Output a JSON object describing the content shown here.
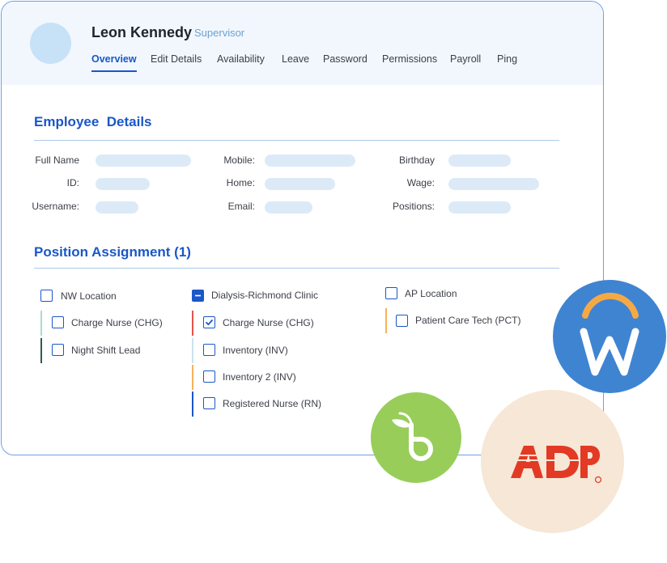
{
  "profile": {
    "name": "Leon Kennedy",
    "role": "Supervisor"
  },
  "tabs": [
    {
      "label": "Overview",
      "active": true
    },
    {
      "label": "Edit Details",
      "active": false
    },
    {
      "label": "Availability",
      "active": false
    },
    {
      "label": "Leave",
      "active": false
    },
    {
      "label": "Password",
      "active": false
    },
    {
      "label": "Permissions",
      "active": false
    },
    {
      "label": "Payroll",
      "active": false
    },
    {
      "label": "Ping",
      "active": false
    }
  ],
  "employee_details": {
    "title": "Employee  Details",
    "fields": [
      {
        "label": "Full Name"
      },
      {
        "label": "ID:"
      },
      {
        "label": "Username:"
      },
      {
        "label": "Mobile:"
      },
      {
        "label": "Home:"
      },
      {
        "label": "Email:"
      },
      {
        "label": "Birthday"
      },
      {
        "label": "Wage:"
      },
      {
        "label": "Positions:"
      }
    ]
  },
  "position_assignment": {
    "title": "Position Assignment (1)",
    "groups": [
      {
        "location": "NW Location",
        "state": "unchecked",
        "positions": [
          {
            "label": "Charge Nurse (CHG)",
            "checked": false,
            "color": "#a9dfc4"
          },
          {
            "label": "Night Shift Lead",
            "checked": false,
            "color": "#2f5b4c"
          }
        ]
      },
      {
        "location": "Dialysis-Richmond Clinic",
        "state": "partial",
        "positions": [
          {
            "label": "Charge Nurse (CHG)",
            "checked": true,
            "color": "#e5534b"
          },
          {
            "label": "Inventory (INV)",
            "checked": false,
            "color": "#c9e3ee"
          },
          {
            "label": "Inventory 2 (INV)",
            "checked": false,
            "color": "#f5b25c"
          },
          {
            "label": "Registered Nurse (RN)",
            "checked": false,
            "color": "#1a57c8"
          }
        ]
      },
      {
        "location": "AP Location",
        "state": "unchecked",
        "positions": [
          {
            "label": "Patient Care Tech (PCT)",
            "checked": false,
            "color": "#f5b25c"
          }
        ]
      }
    ]
  },
  "integrations": {
    "workday": {
      "icon": "workday-logo-icon",
      "bg": "#3f84d1",
      "arc": "#f5a945"
    },
    "bamboohr": {
      "icon": "bamboohr-logo-icon",
      "bg": "#98cd5a"
    },
    "adp": {
      "icon": "adp-logo-icon",
      "bg": "#f6e7d6",
      "fg": "#e23a24"
    }
  },
  "colors": {
    "accent": "#1a57c8",
    "border": "#6f9fe6",
    "placeholder": "#dceaf8"
  }
}
